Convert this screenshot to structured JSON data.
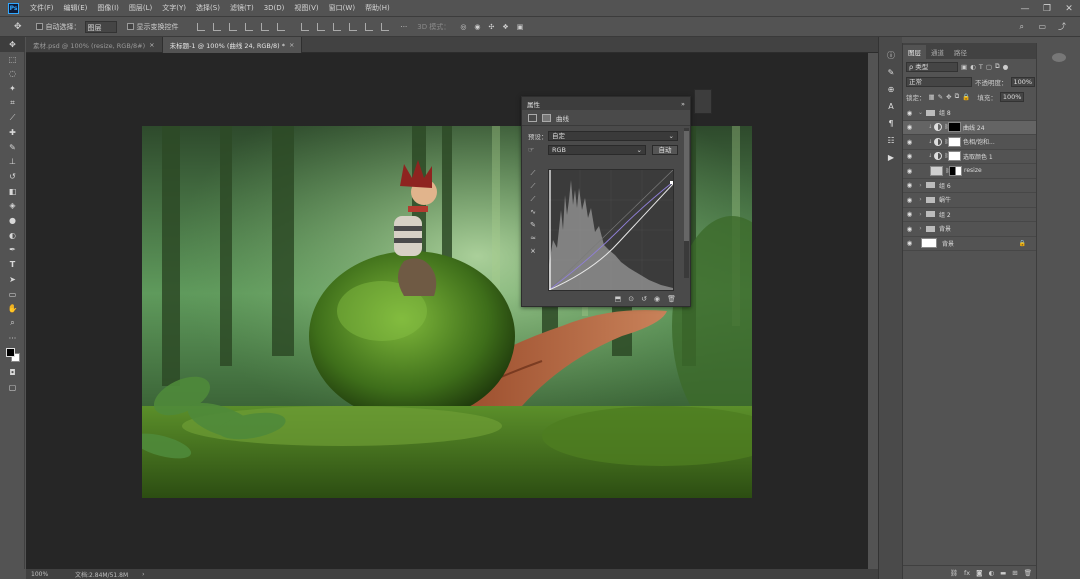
{
  "app": {
    "logo": "Ps"
  },
  "menu": [
    "文件(F)",
    "编辑(E)",
    "图像(I)",
    "图层(L)",
    "文字(Y)",
    "选择(S)",
    "滤镜(T)",
    "3D(D)",
    "视图(V)",
    "窗口(W)",
    "帮助(H)"
  ],
  "window_controls": {
    "minimize": "—",
    "restore": "❐",
    "close": "✕"
  },
  "options": {
    "auto_select_label": "自动选择：",
    "auto_select_value": "图层",
    "show_transform_label": "显示变换控件",
    "mode_3d": "3D 模式：",
    "more": "···"
  },
  "tabs": [
    {
      "label": "素材.psd @ 100% (resize, RGB/8#)",
      "close": "×"
    },
    {
      "label": "未标题-1 @ 100% (曲线 24, RGB/8) *",
      "close": "×"
    }
  ],
  "status": {
    "zoom": "100%",
    "doc": "文档:2.84M/51.8M",
    "arrow": "›"
  },
  "properties": {
    "title": "属性",
    "collapse": "»",
    "menu": "≡",
    "section": "曲线",
    "preset_label": "预设：",
    "preset_value": "自定",
    "channel_value": "RGB",
    "auto_button": "自动"
  },
  "layers_panel": {
    "tabs": [
      "图层",
      "通道",
      "路径"
    ],
    "kind_label": "ρ 类型",
    "blend_mode": "正常",
    "opacity_label": "不透明度：",
    "opacity_value": "100%",
    "lock_label": "锁定：",
    "fill_label": "填充：",
    "fill_value": "100%",
    "layers": [
      {
        "name": "组 8",
        "kind": "group",
        "open": true,
        "selected": false
      },
      {
        "name": "曲线 24",
        "kind": "curves",
        "selected": true
      },
      {
        "name": "色相/饱和...",
        "kind": "hue",
        "selected": false
      },
      {
        "name": "选取颜色 1",
        "kind": "selective",
        "selected": false
      },
      {
        "name": "resize",
        "kind": "smart",
        "selected": false
      },
      {
        "name": "组 6",
        "kind": "group",
        "open": false,
        "selected": false
      },
      {
        "name": "蜗牛",
        "kind": "group",
        "open": false,
        "selected": false
      },
      {
        "name": "组 2",
        "kind": "group",
        "open": false,
        "selected": false
      },
      {
        "name": "背景",
        "kind": "group",
        "open": false,
        "selected": false
      },
      {
        "name": "背景",
        "kind": "background",
        "selected": false
      }
    ]
  },
  "colors": {
    "accent": "#31a8ff",
    "chrome": "#535353",
    "canvas_bg": "#262626"
  }
}
